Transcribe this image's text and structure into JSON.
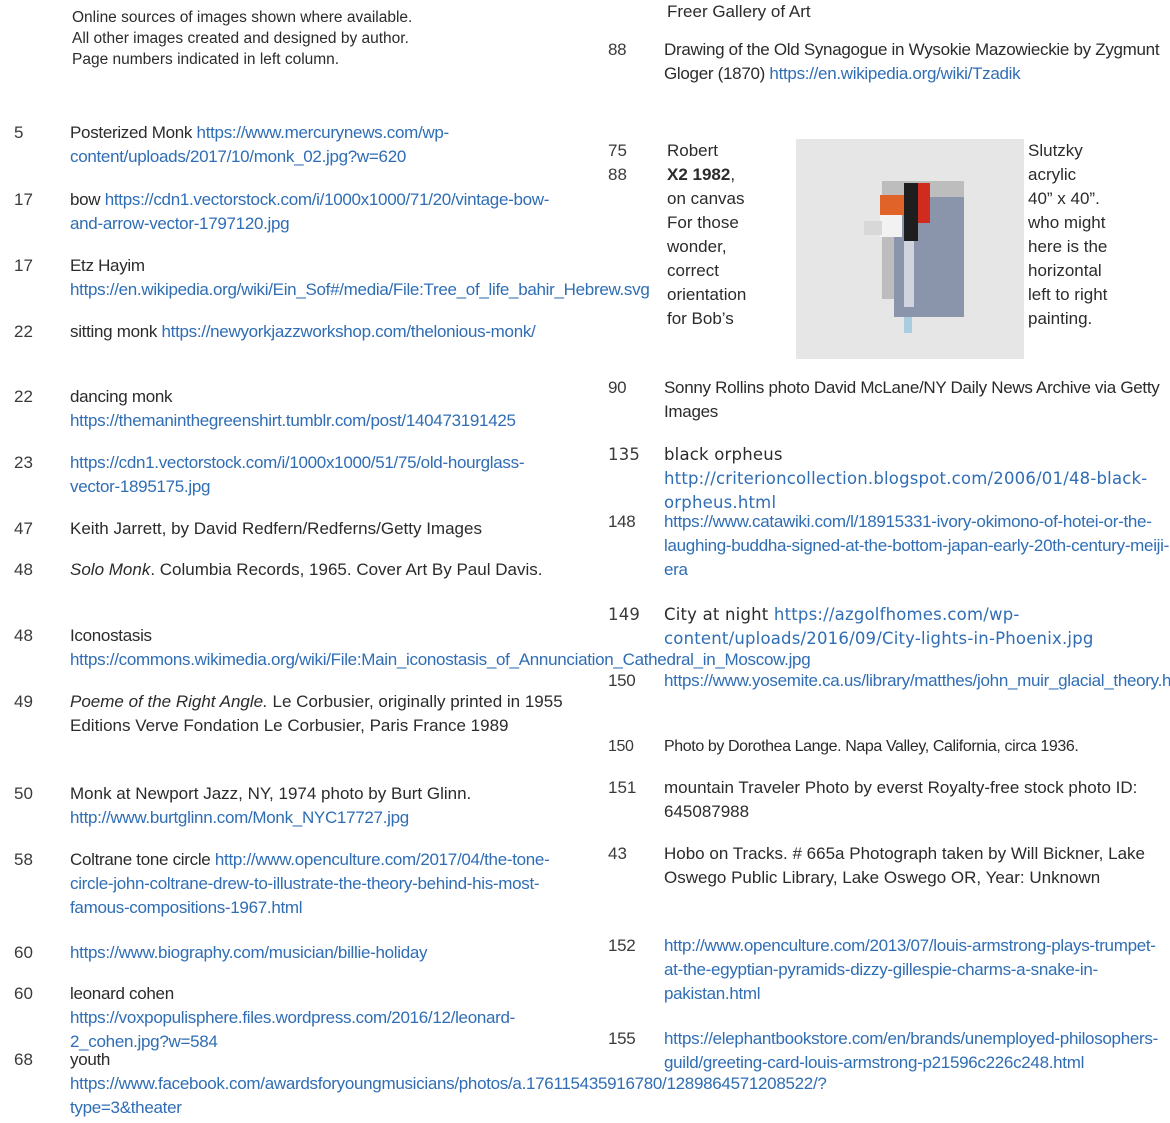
{
  "intro": [
    "Online sources of images shown where available.",
    "All other images created and designed by author.",
    "Page numbers indicated in left column."
  ],
  "left": [
    {
      "page": "5",
      "text": "Posterized Monk ",
      "link": "https://www.mercurynews.com/wp-content/uploads/2017/10/monk_02.jpg?w=620"
    },
    {
      "page": "17",
      "text": "bow ",
      "link": "https://cdn1.vectorstock.com/i/1000x1000/71/20/vintage-bow-and-arrow-vector-1797120.jpg"
    },
    {
      "page": "17",
      "text": "Etz Hayim ",
      "link": "https://en.wikipedia.org/wiki/Ein_Sof#/media/File:Tree_of_life_bahir_Hebrew.svg"
    },
    {
      "page": "22",
      "text": "sitting monk ",
      "link": "https://newyorkjazzworkshop.com/thelonious-monk/"
    },
    {
      "page": "22",
      "text": "dancing monk ",
      "link": "https://themaninthegreenshirt.tumblr.com/post/140473191425"
    },
    {
      "page": "23",
      "text": "",
      "link": "https://cdn1.vectorstock.com/i/1000x1000/51/75/old-hourglass-vector-1895175.jpg"
    },
    {
      "page": "47",
      "text": "Keith Jarrett, by David Redfern/Redferns/Getty Images",
      "link": ""
    },
    {
      "page": "48",
      "italic": "Solo Monk",
      "text": ". Columbia Records, 1965. Cover Art By Paul Davis.",
      "link": ""
    },
    {
      "page": "48",
      "text": "Iconostasis ",
      "link": "https://commons.wikimedia.org/wiki/File:Main_iconostasis_of_Annunciation_Cathedral_in_Moscow.jpg"
    },
    {
      "page": "49",
      "italic": "Poeme of the Right Angle.",
      "text": " Le Corbusier, originally printed in 1955 Editions Verve  Fondation Le Corbusier, Paris France 1989",
      "link": ""
    },
    {
      "page": "50",
      "text": "Monk at Newport Jazz, NY, 1974 photo by Burt Glinn. ",
      "link": "http://www.burtglinn.com/Monk_NYC17727.jpg"
    },
    {
      "page": "58",
      "text": "Coltrane tone circle ",
      "link": "http://www.openculture.com/2017/04/the-tone-circle-john-coltrane-drew-to-illustrate-the-theory-behind-his-most-famous-compositions-1967.html"
    },
    {
      "page": "60",
      "text": "",
      "link": "https://www.biography.com/musician/billie-holiday"
    },
    {
      "page": "60",
      "text": "leonard cohen ",
      "link": "https://voxpopulisphere.files.wordpress.com/2016/12/leonard-2_cohen.jpg?w=584"
    },
    {
      "page": "68",
      "text": "youth ",
      "link": "https://www.facebook.com/awardsforyoungmusicians/photos/a.176115435916780/1289864571208522/?type=3&theater"
    }
  ],
  "right": {
    "top_fragment": "Freer Gallery of Art",
    "entries": [
      {
        "page": "88",
        "text": "Drawing of the Old Synagogue in Wysokie Mazowieckie by Zygmunt Gloger (1870)  ",
        "link": "https://en.wikipedia.org/wiki/Tzadik"
      },
      {
        "page": "90",
        "text": "Sonny Rollins photo David McLane/NY Daily News Archive via Getty Images",
        "link": ""
      },
      {
        "page": "135",
        "text": "black orpheus  ",
        "link": "http://criterioncollection.blogspot.com/2006/01/48-black-orpheus.html"
      },
      {
        "page": "148",
        "text": "",
        "link": "https://www.catawiki.com/l/18915331-ivory-okimono-of-hotei-or-the-laughing-buddha-signed-at-the-bottom-japan-early-20th-century-meiji-era"
      },
      {
        "page": "149",
        "text": "City at night ",
        "link": "https://azgolfhomes.com/wp-content/uploads/2016/09/City-lights-in-Phoenix.jpg"
      },
      {
        "page": "150",
        "text": "",
        "link": "https://www.yosemite.ca.us/library/matthes/john_muir_glacial_theory.html"
      },
      {
        "page": "150",
        "text": "Photo by Dorothea Lange. Napa Valley, California, circa 1936.",
        "link": ""
      },
      {
        "page": "151",
        "text": "mountain Traveler  Photo by everst Royalty-free stock photo ID: 645087988",
        "link": ""
      },
      {
        "page": "43",
        "text": "Hobo on Tracks. # 665a Photograph taken by Will Bickner, Lake Oswego Public Library, Lake Oswego OR, Year: Unknown",
        "link": ""
      },
      {
        "page": "152",
        "text": "",
        "link": "http://www.openculture.com/2013/07/louis-armstrong-plays-trumpet-at-the-egyptian-pyramids-dizzy-gillespie-charms-a-snake-in-pakistan.html"
      },
      {
        "page": "155",
        "text": "",
        "link": "https://elephantbookstore.com/en/brands/unemployed-philosophers-guild/greeting-card-louis-armstrong-p21596c226c248.html"
      }
    ],
    "painting": {
      "pages": [
        "75",
        "88"
      ],
      "left_lines": [
        "Robert",
        "X2 1982",
        ",",
        "on canvas",
        "For those",
        "wonder,",
        "correct",
        "orientation",
        "for Bob’s"
      ],
      "right_lines": [
        "Slutzky",
        "acrylic",
        "40” x 40”.",
        "who might",
        "here is the",
        "horizontal",
        "left to right",
        "painting."
      ]
    }
  }
}
